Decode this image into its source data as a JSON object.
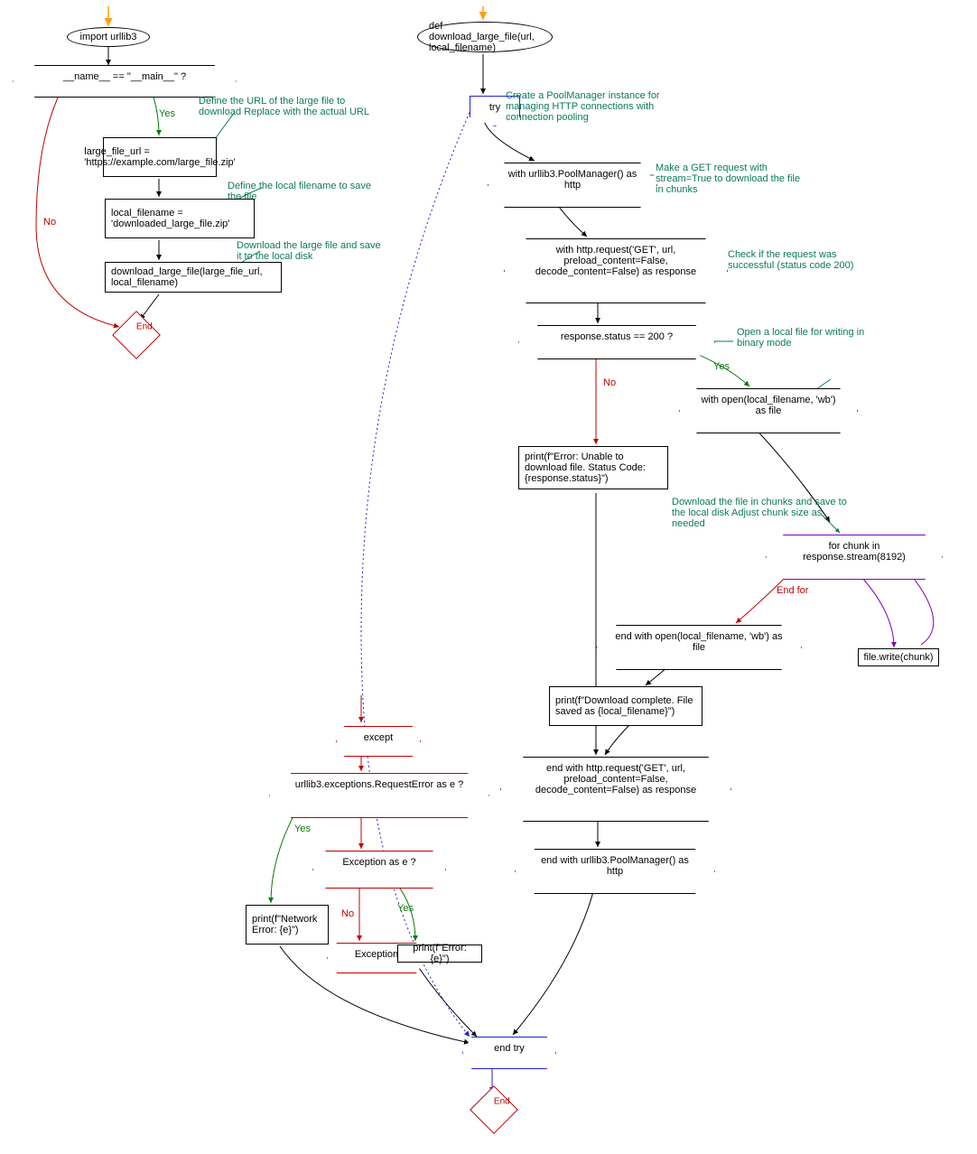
{
  "left": {
    "import": "import urllib3",
    "cond": "__name__ == \"__main__\" ?",
    "c1": "Define the URL of the large file to download\nReplace with the actual URL",
    "box1": "large_file_url = 'https://example.com/large_file.zip'",
    "c2": "Define the local filename to save the file",
    "box2": "local_filename = 'downloaded_large_file.zip'",
    "c3": "Download the large file and save it to the local disk",
    "box3": "download_large_file(large_file_url, local_filename)",
    "end": "End",
    "yes": "Yes",
    "no": "No"
  },
  "right": {
    "def": "def download_large_file(url, local_filename)",
    "try": "try",
    "c_try": "Create a PoolManager instance for managing HTTP connections with connection pooling",
    "with1": "with urllib3.PoolManager() as http",
    "c_w1": "Make a GET request with stream=True to download the file in chunks",
    "with2": "with http.request('GET', url, preload_content=False, decode_content=False) as response",
    "c_w2": "Check if the request was successful (status code 200)",
    "cond": "response.status == 200 ?",
    "c_cond": "Open a local file for writing in binary mode",
    "yes": "Yes",
    "no": "No",
    "with3": "with open(local_filename, 'wb') as file",
    "c_loop": "Download the file in chunks and save to the local disk\nAdjust chunk size as needed",
    "loop": "for chunk in response.stream(8192)",
    "write": "file.write(chunk)",
    "endfor": "End for",
    "err_print": "print(f\"Error: Unable to download file. Status Code: {response.status}\")",
    "endwith3": "end with open(local_filename, 'wb') as file",
    "done_print": "print(f\"Download complete. File saved as {local_filename}\")",
    "endwith2": "end with http.request('GET', url, preload_content=False, decode_content=False) as response",
    "endwith1": "end with urllib3.PoolManager() as http",
    "except": "except",
    "excond1": "urllib3.exceptions.RequestError as e ?",
    "excond2": "Exception as e ?",
    "p_net": "print(f\"Network Error: {e}\")",
    "p_err": "print(f\"Error: {e}\")",
    "exception": "Exception",
    "endtry": "end try",
    "end": "End"
  }
}
